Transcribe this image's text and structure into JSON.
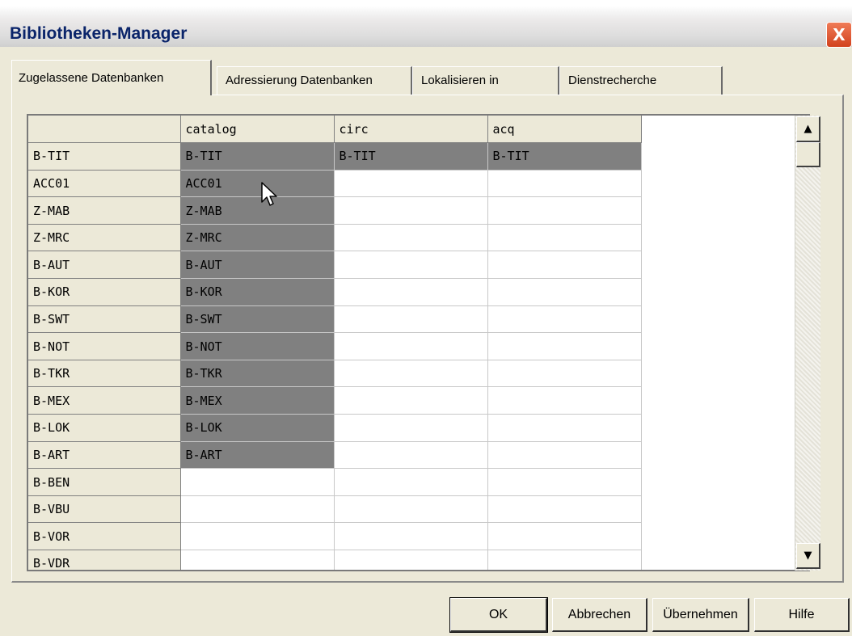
{
  "window": {
    "title": "Bibliotheken-Manager",
    "close_label": "X"
  },
  "tabs": [
    {
      "label": "Zugelassene Datenbanken"
    },
    {
      "label": "Adressierung Datenbanken"
    },
    {
      "label": "Lokalisieren in"
    },
    {
      "label": "Dienstrecherche"
    }
  ],
  "grid": {
    "columns": [
      "catalog",
      "circ",
      "acq"
    ],
    "rows": [
      {
        "label": "B-TIT",
        "cells": [
          "B-TIT",
          "B-TIT",
          "B-TIT"
        ]
      },
      {
        "label": "ACC01",
        "cells": [
          "ACC01",
          "",
          ""
        ]
      },
      {
        "label": "Z-MAB",
        "cells": [
          "Z-MAB",
          "",
          ""
        ]
      },
      {
        "label": "Z-MRC",
        "cells": [
          "Z-MRC",
          "",
          ""
        ]
      },
      {
        "label": "B-AUT",
        "cells": [
          "B-AUT",
          "",
          ""
        ]
      },
      {
        "label": "B-KOR",
        "cells": [
          "B-KOR",
          "",
          ""
        ]
      },
      {
        "label": "B-SWT",
        "cells": [
          "B-SWT",
          "",
          ""
        ]
      },
      {
        "label": "B-NOT",
        "cells": [
          "B-NOT",
          "",
          ""
        ]
      },
      {
        "label": "B-TKR",
        "cells": [
          "B-TKR",
          "",
          ""
        ]
      },
      {
        "label": "B-MEX",
        "cells": [
          "B-MEX",
          "",
          ""
        ]
      },
      {
        "label": "B-LOK",
        "cells": [
          "B-LOK",
          "",
          ""
        ]
      },
      {
        "label": "B-ART",
        "cells": [
          "B-ART",
          "",
          ""
        ]
      },
      {
        "label": "B-BEN",
        "cells": [
          "",
          "",
          ""
        ]
      },
      {
        "label": "B-VBU",
        "cells": [
          "",
          "",
          ""
        ]
      },
      {
        "label": "B-VOR",
        "cells": [
          "",
          "",
          ""
        ]
      },
      {
        "label": "B-VDR",
        "cells": [
          "",
          "",
          ""
        ]
      }
    ]
  },
  "scrollbar": {
    "up_glyph": "▲",
    "down_glyph": "▼"
  },
  "buttons": {
    "ok": "OK",
    "cancel": "Abbrechen",
    "apply": "Übernehmen",
    "help": "Hilfe"
  },
  "colors": {
    "filled_cell": "#808080",
    "title_text": "#0a246a",
    "close_button": "#d2421e"
  },
  "icons": {
    "cursor": "mouse-pointer-icon"
  }
}
